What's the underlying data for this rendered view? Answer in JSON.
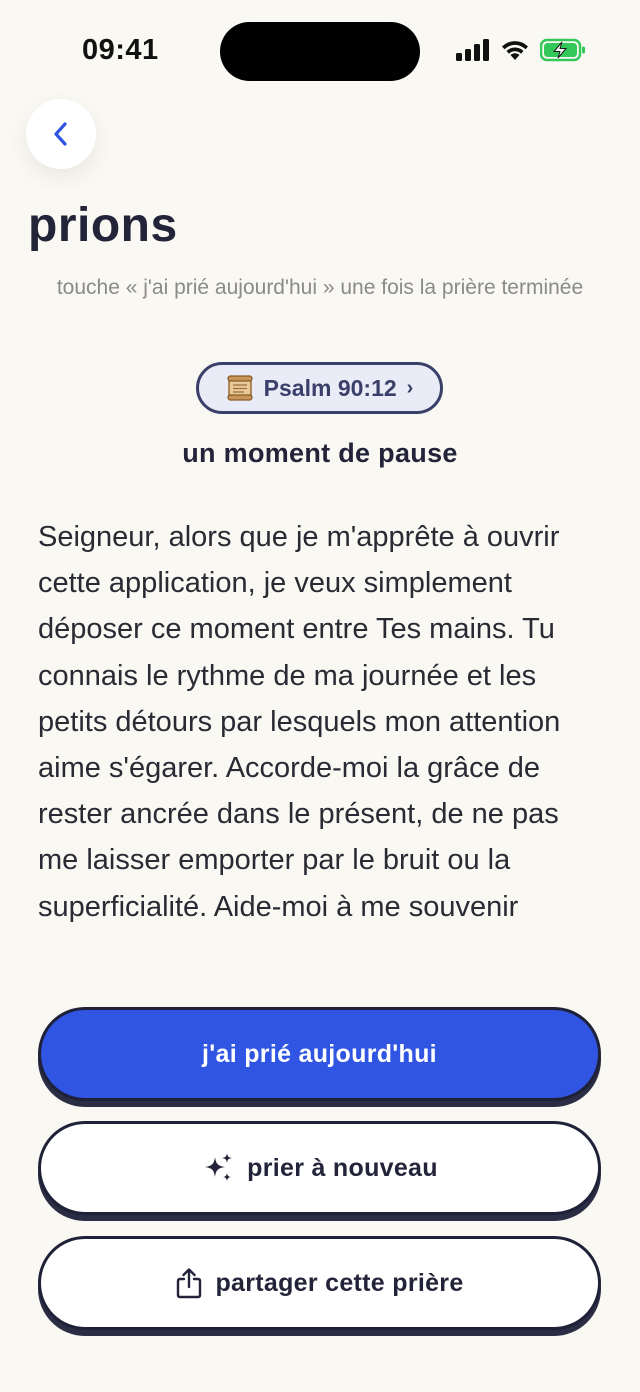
{
  "status_bar": {
    "time": "09:41"
  },
  "header": {
    "back_icon": "chevron-left-icon",
    "title": "prions",
    "hint": "touche « j'ai prié aujourd'hui » une fois la prière terminée"
  },
  "verse": {
    "icon": "scroll-icon",
    "reference": "Psalm 90:12",
    "chevron": "›"
  },
  "prayer": {
    "subtitle": "un moment de pause",
    "body": "Seigneur, alors que je m'apprête à ouvrir cette application, je veux simplement déposer ce moment entre Tes mains. Tu connais le rythme de ma journée et les petits détours par lesquels mon attention aime s'égarer. Accorde-moi la grâce de rester ancrée dans le présent, de ne pas me laisser emporter par le bruit ou la superficialité. Aide-moi à me souvenir"
  },
  "actions": {
    "prayed_label": "j'ai prié aujourd'hui",
    "pray_again_label": "prier à nouveau",
    "pray_again_icon": "sparkles-icon",
    "share_label": "partager cette prière",
    "share_icon": "share-icon"
  },
  "colors": {
    "background": "#FAF8F2",
    "primary": "#2F55E2",
    "ink": "#23233A",
    "chip_bg": "#E9ECF7",
    "battery": "#34C759"
  }
}
